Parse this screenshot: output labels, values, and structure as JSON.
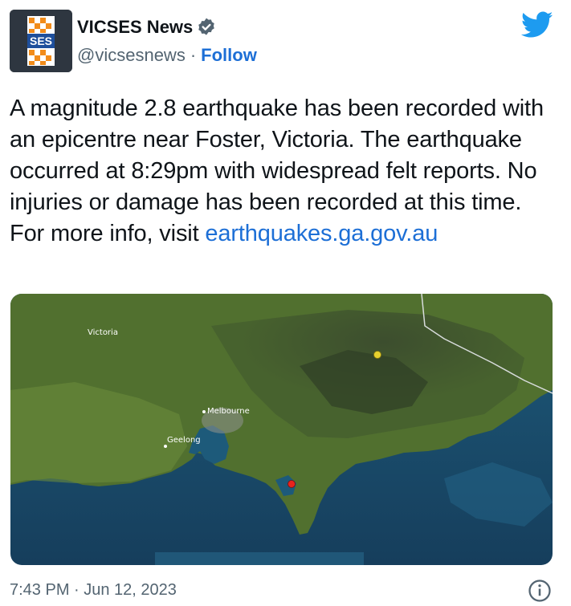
{
  "author": {
    "logo_text": "SES",
    "display_name": "VICSES News",
    "handle": "@vicsesnews",
    "separator": "·",
    "follow_label": "Follow"
  },
  "tweet": {
    "text": "A magnitude 2.8 earthquake has been recorded with an epicentre near Foster, Victoria. The earthquake occurred at 8:29pm with widespread felt reports. No injuries or damage has been recorded at this time. For more info, visit ",
    "link_text": "earthquakes.ga.gov.au"
  },
  "map": {
    "labels": {
      "victoria": "Victoria",
      "melbourne": "Melbourne",
      "geelong": "Geelong"
    },
    "markers": [
      {
        "name": "felt-report-marker",
        "color": "#e6d02e"
      },
      {
        "name": "epicentre-marker",
        "color": "#e8231c"
      }
    ]
  },
  "footer": {
    "timestamp": "7:43 PM · Jun 12, 2023"
  },
  "colors": {
    "link": "#1d6fd6",
    "muted": "#536471",
    "twitter_blue": "#1d9bf0",
    "ses_orange": "#f28c1b"
  },
  "icons": {
    "verified": "verified-badge-icon",
    "brand": "twitter-bird-icon",
    "info": "info-icon"
  }
}
